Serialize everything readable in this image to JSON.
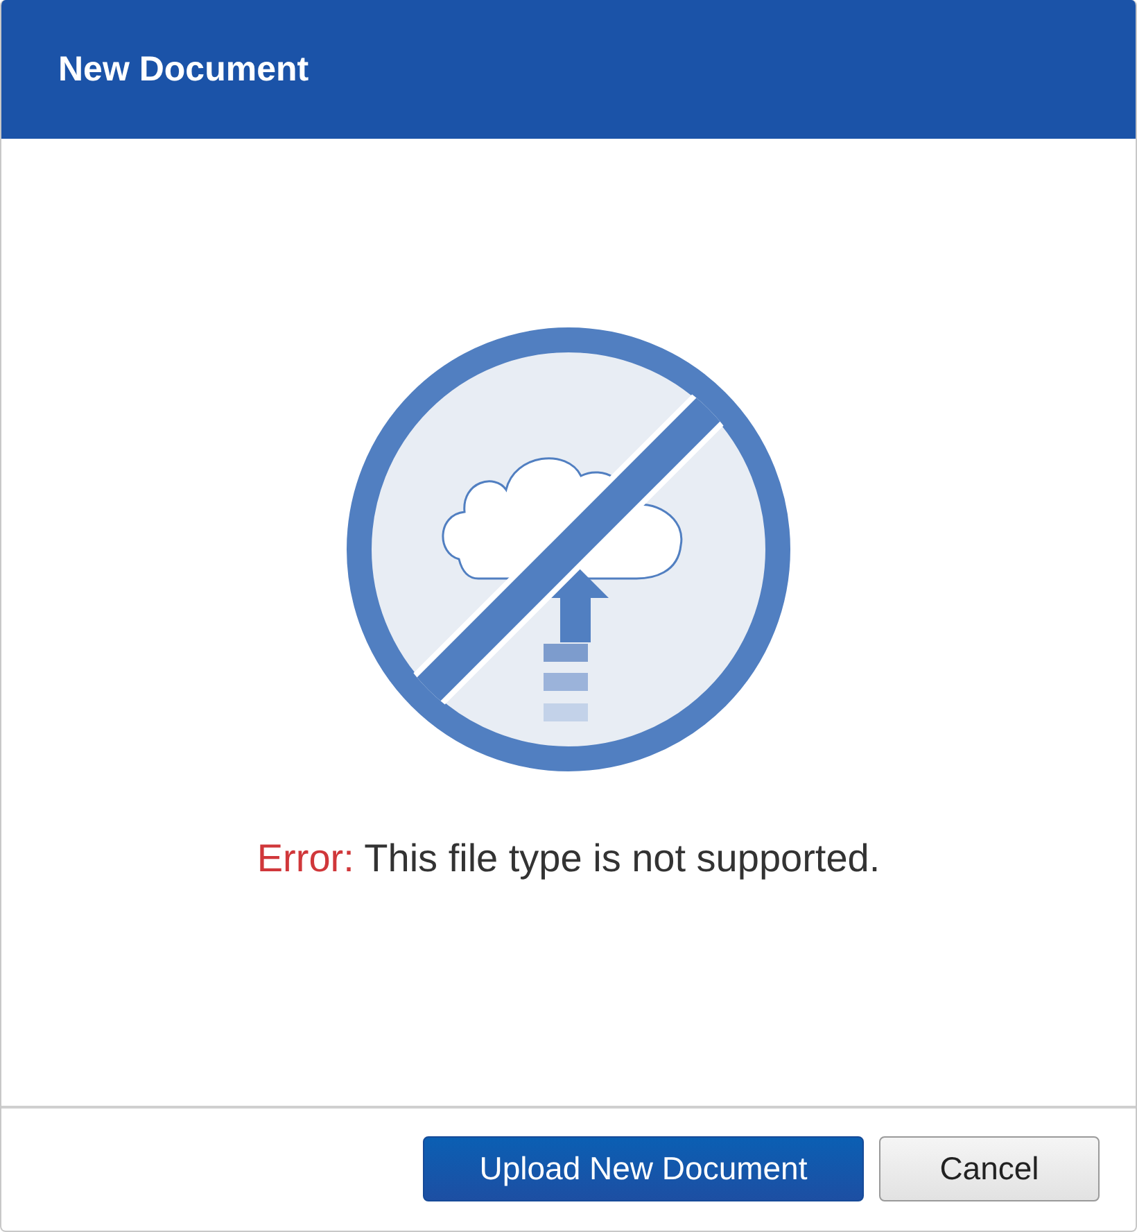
{
  "dialog": {
    "title": "New Document"
  },
  "message": {
    "label": "Error:",
    "text": "This file type is not supported."
  },
  "buttons": [
    {
      "label": "Upload New Document",
      "kind": "primary"
    },
    {
      "label": "Cancel",
      "kind": "secondary"
    }
  ]
}
